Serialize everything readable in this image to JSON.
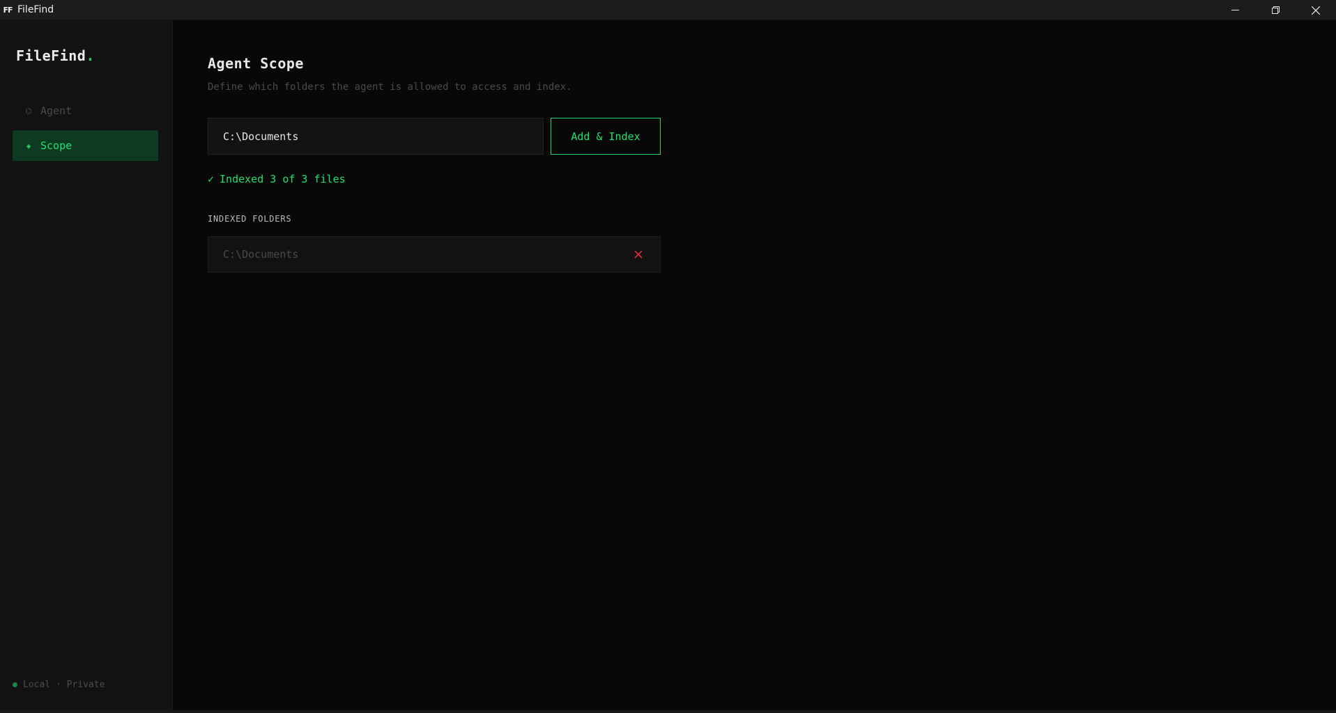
{
  "window": {
    "title": "FileFind",
    "icon_text": "FF",
    "controls": [
      "minimize-icon",
      "restore-icon",
      "close-icon"
    ]
  },
  "sidebar": {
    "brand": "FileFind",
    "brand_dot": ".",
    "items": [
      {
        "label": "Agent",
        "icon": "⌬",
        "active": false
      },
      {
        "label": "Scope",
        "icon": "◈",
        "active": true
      }
    ],
    "footer": "Local · Private"
  },
  "main": {
    "title": "Agent Scope",
    "subtitle": "Define which folders the agent is allowed to access and index.",
    "path_input_value": "C:\\Documents",
    "add_button_label": "Add & Index",
    "status_check": "✓",
    "status_text": "Indexed 3 of 3 files",
    "section_label": "INDEXED FOLDERS",
    "folders": [
      {
        "path": "C:\\Documents"
      }
    ]
  },
  "colors": {
    "accent": "#22e070",
    "remove": "#e0303a",
    "background": "#080808",
    "sidebar": "#121212"
  }
}
